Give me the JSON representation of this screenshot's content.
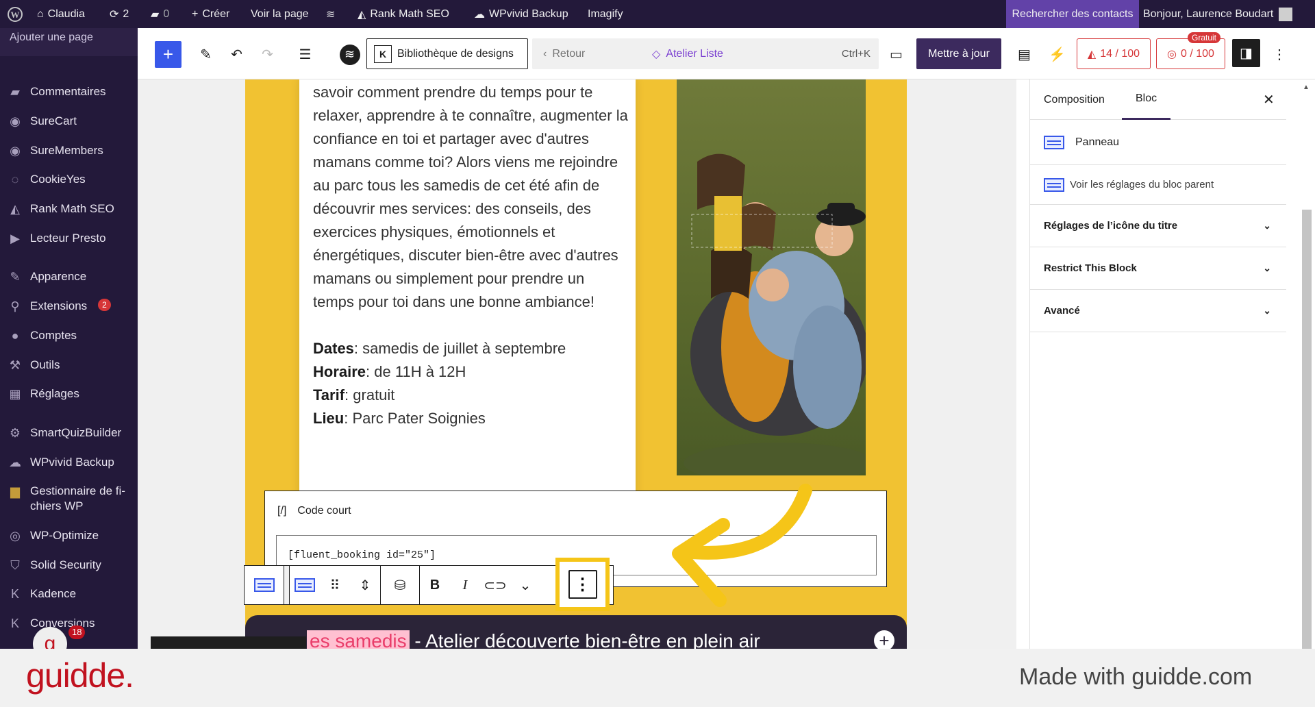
{
  "adminbar": {
    "site_name": "Claudia",
    "updates_count": "2",
    "comments_count": "0",
    "create_label": "Créer",
    "view_page_label": "Voir la page",
    "rankmath_label": "Rank Math SEO",
    "wpvivid_label": "WPvivid Backup",
    "imagify_label": "Imagify",
    "search_contacts_label": "Rechercher des contacts",
    "greeting": "Bonjour, Laurence Boudart"
  },
  "sidebar": {
    "current_item": "Ajouter une page",
    "items": [
      {
        "label": "Commentaires",
        "icon": "comment-icon"
      },
      {
        "label": "SureCart",
        "icon": "surecart-icon"
      },
      {
        "label": "SureMembers",
        "icon": "suremembers-icon"
      },
      {
        "label": "CookieYes",
        "icon": "cookie-icon"
      },
      {
        "label": "Rank Math SEO",
        "icon": "rankmath-icon"
      },
      {
        "label": "Lecteur Presto",
        "icon": "presto-icon"
      },
      {
        "label": "Apparence",
        "icon": "brush-icon"
      },
      {
        "label": "Extensions",
        "icon": "plugin-icon",
        "badge": "2"
      },
      {
        "label": "Comptes",
        "icon": "user-icon"
      },
      {
        "label": "Outils",
        "icon": "wrench-icon"
      },
      {
        "label": "Réglages",
        "icon": "settings-icon"
      },
      {
        "label": "SmartQuizBuilder",
        "icon": "gear-icon"
      },
      {
        "label": "WPvivid Backup",
        "icon": "cloud-icon"
      },
      {
        "label": "Gestionnaire de fi-chiers WP",
        "icon": "folder-icon"
      },
      {
        "label": "WP-Optimize",
        "icon": "optimize-icon"
      },
      {
        "label": "Solid Security",
        "icon": "shield-icon"
      },
      {
        "label": "Kadence",
        "icon": "kadence-icon"
      },
      {
        "label": "Conversions",
        "icon": "conversions-icon"
      }
    ],
    "notification_count": "18"
  },
  "header": {
    "design_library_label": "Bibliothèque de designs",
    "back_label": "Retour",
    "page_title": "Atelier Liste",
    "shortcut": "Ctrl+K",
    "update_label": "Mettre à jour",
    "seo_score": "14 / 100",
    "readability_score": "0 / 100",
    "free_badge": "Gratuit"
  },
  "canvas": {
    "paragraph": "savoir comment prendre du temps pour te relaxer, apprendre à te connaître, augmenter la confiance en toi et partager avec d'autres mamans comme toi? Alors viens me rejoindre au parc tous les samedis de cet été afin de découvrir mes services: des conseils, des exercices physiques, émotionnels et énergétiques, discuter bien-être avec d'autres mamans ou simplement pour prendre un temps pour toi dans une bonne ambiance!",
    "details": [
      {
        "label": "Dates",
        "value": ": samedis de juillet à septembre"
      },
      {
        "label": "Horaire",
        "value": ": de 11H à 12H"
      },
      {
        "label": "Tarif",
        "value": ": gratuit"
      },
      {
        "label": "Lieu",
        "value": ": Parc Pater Soignies"
      }
    ],
    "shortcode_label": "Code court",
    "shortcode_value": "[fluent_booking id=\"25\"]",
    "next_heading_highlight": "es samedis",
    "next_heading_rest": " - Atelier découverte bien-être en plein air"
  },
  "inspector": {
    "tab_composition": "Composition",
    "tab_bloc": "Bloc",
    "block_name": "Panneau",
    "parent_settings": "Voir les réglages du bloc parent",
    "panels": [
      "Réglages de l’icône du titre",
      "Restrict This Block",
      "Avancé"
    ]
  },
  "footer": {
    "brand": "guidde.",
    "made_with": "Made with guidde.com"
  },
  "colors": {
    "admin_bg": "#23193a",
    "accent_yellow": "#f1c232",
    "highlight_yellow": "#f5c518",
    "guidde_red": "#c1121f"
  }
}
